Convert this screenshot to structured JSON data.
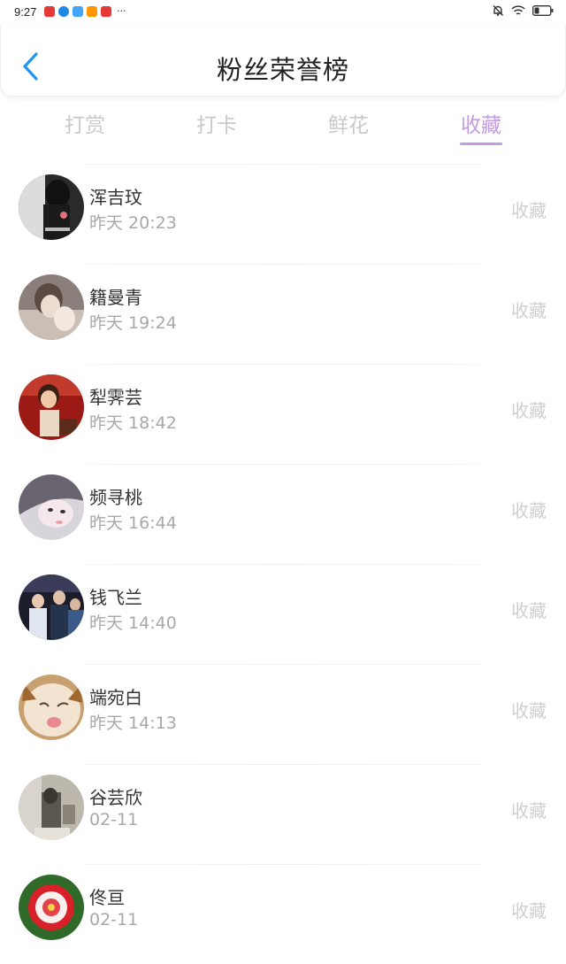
{
  "status_bar": {
    "time": "9:27",
    "dots": "···",
    "app_icon_colors": [
      "#e53935",
      "#1e88e5",
      "#42a5f5",
      "#ff9800",
      "#e53935"
    ]
  },
  "header": {
    "title": "粉丝荣誉榜",
    "back_icon": "chevron-left-icon",
    "accent": "#2196f3"
  },
  "tabs": {
    "active_color": "#c39be0",
    "items": [
      {
        "label": "打赏"
      },
      {
        "label": "打卡"
      },
      {
        "label": "鲜花"
      },
      {
        "label": "收藏"
      }
    ]
  },
  "list": {
    "items": [
      {
        "name": "浑吉玟",
        "time": "昨天 20:23",
        "action": "收藏"
      },
      {
        "name": "籍曼青",
        "time": "昨天 19:24",
        "action": "收藏"
      },
      {
        "name": "犁霁芸",
        "time": "昨天 18:42",
        "action": "收藏"
      },
      {
        "name": "频寻桃",
        "time": "昨天 16:44",
        "action": "收藏"
      },
      {
        "name": "钱飞兰",
        "time": "昨天 14:40",
        "action": "收藏"
      },
      {
        "name": "端宛白",
        "time": "昨天 14:13",
        "action": "收藏"
      },
      {
        "name": "谷芸欣",
        "time": "02-11",
        "action": "收藏"
      },
      {
        "name": "佟亘",
        "time": "02-11",
        "action": "收藏"
      }
    ]
  }
}
